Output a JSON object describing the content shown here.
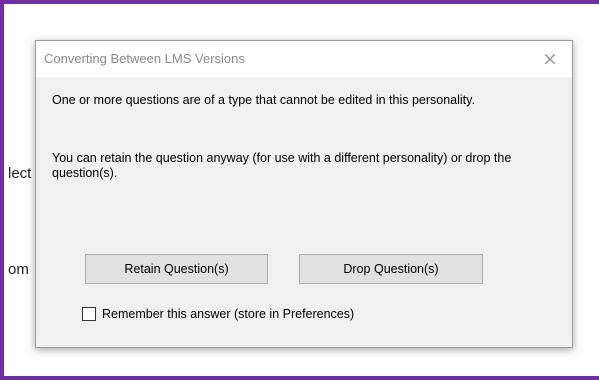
{
  "background": {
    "fragment1": "lect",
    "fragment2": "om"
  },
  "dialog": {
    "title": "Converting Between LMS Versions",
    "close_icon": "×",
    "message1": "One or more questions are of a type that cannot be edited in this personality.",
    "message2": "You can retain the question anyway (for use with a different personality) or drop the question(s).",
    "retain_label": "Retain Question(s)",
    "drop_label": "Drop Question(s)",
    "remember_label": "Remember this answer (store in Preferences)",
    "remember_checked": false
  },
  "colors": {
    "frame_border": "#7030a0",
    "dialog_bg": "#f0f0f0"
  }
}
